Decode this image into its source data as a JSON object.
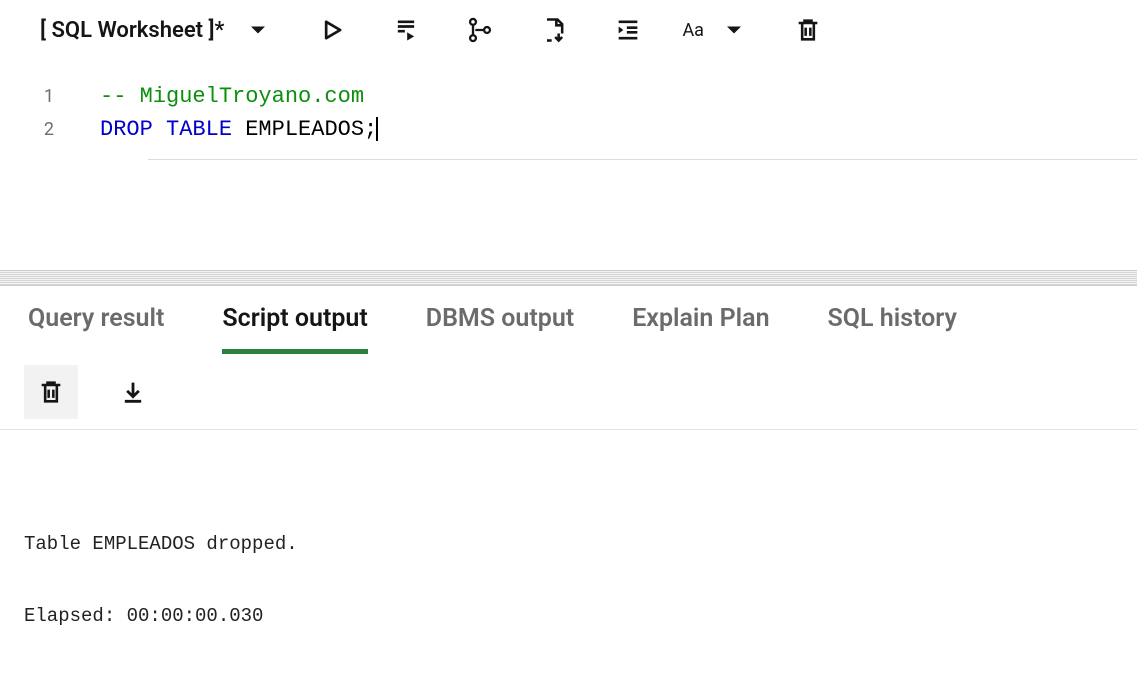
{
  "worksheet": {
    "title": "[ SQL Worksheet ]*"
  },
  "toolbar": {
    "font_size_label": "Aa"
  },
  "editor": {
    "lines": [
      {
        "num": "1",
        "tokens": [
          {
            "cls": "tok-comment",
            "t": "-- MiguelTroyano.com"
          }
        ]
      },
      {
        "num": "2",
        "tokens": [
          {
            "cls": "tok-keyword",
            "t": "DROP"
          },
          {
            "cls": "tok-text",
            "t": " "
          },
          {
            "cls": "tok-keyword",
            "t": "TABLE"
          },
          {
            "cls": "tok-text",
            "t": " EMPLEADOS;"
          }
        ],
        "cursorAfter": true
      }
    ]
  },
  "tabs": [
    {
      "label": "Query result",
      "active": false
    },
    {
      "label": "Script output",
      "active": true
    },
    {
      "label": "DBMS output",
      "active": false
    },
    {
      "label": "Explain Plan",
      "active": false
    },
    {
      "label": "SQL history",
      "active": false
    }
  ],
  "output": {
    "line1": "Table EMPLEADOS dropped.",
    "line2": "Elapsed: 00:00:00.030"
  }
}
